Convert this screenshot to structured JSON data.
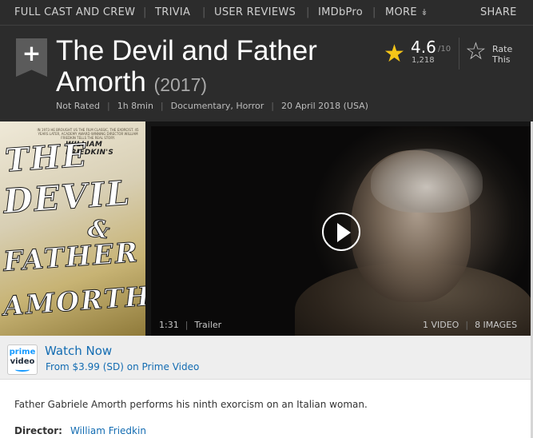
{
  "subnav": {
    "items": [
      "FULL CAST AND CREW",
      "TRIVIA",
      "USER REVIEWS",
      "IMDbPro",
      "MORE"
    ],
    "share": "SHARE",
    "more_icon": "double-chevron-down-icon"
  },
  "watchlist": {
    "icon": "plus-icon",
    "symbol": "+"
  },
  "title": {
    "name": "The Devil and Father Amorth",
    "year": "(2017)"
  },
  "meta": {
    "certificate": "Not Rated",
    "runtime": "1h 8min",
    "genres": "Documentary, Horror",
    "release": "20 April 2018 (USA)"
  },
  "rating": {
    "value": "4.6",
    "max": "/10",
    "count": "1,218",
    "star_color": "#f5c518",
    "rate_label": "Rate This"
  },
  "poster": {
    "fine_print": "IN 1973 HE BROUGHT US THE FILM CLASSIC, THE EXORCIST. 45 YEARS LATER, ACADEMY AWARD WINNING DIRECTOR WILLIAM FRIEDKIN TELLS THE REAL STORY.",
    "director_credit": "WILLIAM FRIEDKIN'S",
    "words": [
      "THE",
      "DEVIL",
      "&",
      "FATHER",
      "AMORTH"
    ]
  },
  "video": {
    "duration": "1:31",
    "type": "Trailer",
    "video_count": "1 VIDEO",
    "image_count": "8 IMAGES"
  },
  "watch": {
    "badge_line1": "prime",
    "badge_line2": "video",
    "title": "Watch Now",
    "subtitle": "From $3.99 (SD) on Prime Video",
    "accent": "#136cb2"
  },
  "summary": {
    "text": "Father Gabriele Amorth performs his ninth exorcism on an Italian woman."
  },
  "director": {
    "label": "Director:",
    "name": "William Friedkin"
  }
}
